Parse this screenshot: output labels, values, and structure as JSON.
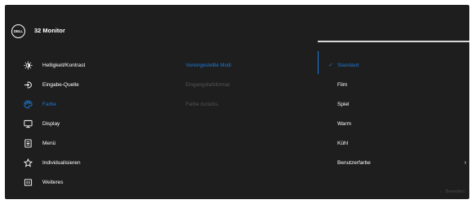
{
  "header": {
    "logo": "DELL",
    "title": "32 Monitor"
  },
  "menu": {
    "items": [
      {
        "label": "Helligkeit/Kontrast",
        "icon": "brightness-icon"
      },
      {
        "label": "Eingabe-Quelle",
        "icon": "input-source-icon"
      },
      {
        "label": "Farbe",
        "icon": "color-palette-icon",
        "active": true
      },
      {
        "label": "Display",
        "icon": "display-icon"
      },
      {
        "label": "Menü",
        "icon": "menu-icon"
      },
      {
        "label": "Individualisieren",
        "icon": "star-icon"
      },
      {
        "label": "Weiteres",
        "icon": "others-icon"
      }
    ]
  },
  "submenu": {
    "items": [
      {
        "label": "Voreingestellte Modi",
        "active": true
      },
      {
        "label": "Eingangsfarbformat"
      },
      {
        "label": "Farbe zurücks."
      }
    ]
  },
  "options": {
    "items": [
      {
        "label": "Standard",
        "selected": true
      },
      {
        "label": "Film"
      },
      {
        "label": "Spiel"
      },
      {
        "label": "Warm"
      },
      {
        "label": "Kühl"
      },
      {
        "label": "Benutzerfarbe",
        "has_submenu": true
      }
    ]
  },
  "footer": {
    "exit_label": "Beenden",
    "exit_icon": "chevron-left-icon"
  },
  "colors": {
    "accent": "#1c7ad8",
    "background": "#1e1e1e",
    "text": "#ffffff",
    "disabled": "#555555"
  }
}
